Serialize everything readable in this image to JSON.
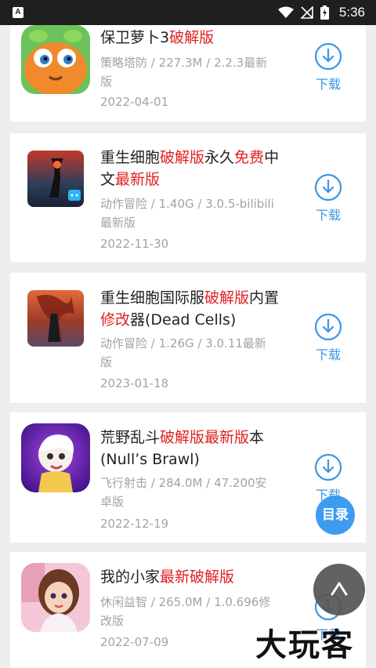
{
  "status_bar": {
    "app_icon_letter": "A",
    "time": "5:36"
  },
  "download_label": "下载",
  "games": [
    {
      "title": [
        {
          "t": "保卫萝卜3"
        },
        {
          "t": "破解版",
          "hl": true
        }
      ],
      "meta": "策略塔防 / 227.3M / 2.2.3最新版",
      "date": "2022-04-01",
      "icon": "carrot-game-icon"
    },
    {
      "title": [
        {
          "t": "重生细胞"
        },
        {
          "t": "破解版",
          "hl": true
        },
        {
          "t": "永久"
        },
        {
          "t": "免费",
          "hl": true
        },
        {
          "t": "中文"
        },
        {
          "t": "最新版",
          "hl": true
        }
      ],
      "meta": "动作冒险 / 1.40G / 3.0.5-bilibili最新版",
      "date": "2022-11-30",
      "icon": "dead-cells-bilibili-icon"
    },
    {
      "title": [
        {
          "t": "重生细胞国际服"
        },
        {
          "t": "破解版",
          "hl": true
        },
        {
          "t": "内置"
        },
        {
          "t": "修改",
          "hl": true
        },
        {
          "t": "器(Dead Cells)"
        }
      ],
      "meta": "动作冒险 / 1.26G / 3.0.11最新版",
      "date": "2023-01-18",
      "icon": "dead-cells-icon"
    },
    {
      "title": [
        {
          "t": "荒野乱斗"
        },
        {
          "t": "破解版最新版",
          "hl": true
        },
        {
          "t": "本(Null’s Brawl)"
        }
      ],
      "meta": "飞行射击 / 284.0M / 47.200安卓版",
      "date": "2022-12-19",
      "icon": "brawl-stars-icon"
    },
    {
      "title": [
        {
          "t": "我的小家"
        },
        {
          "t": "最新破解版",
          "hl": true
        }
      ],
      "meta": "休闲益智 / 265.0M / 1.0.696修改版",
      "date": "2022-07-09",
      "icon": "my-home-girl-icon"
    }
  ],
  "floating": {
    "toc_label": "目录",
    "back_to_top_icon": "arrow-up-icon"
  },
  "watermark": "大玩客",
  "colors": {
    "highlight": "#e02020",
    "accent": "#3c96e6",
    "meta_text": "#a3a3a3"
  }
}
